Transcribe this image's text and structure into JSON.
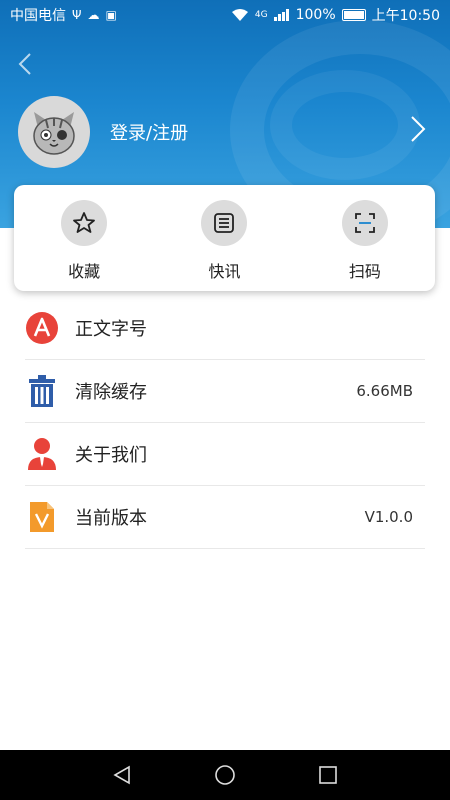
{
  "status_bar": {
    "carrier": "中国电信",
    "signal_type": "4G",
    "battery_percent": "100%",
    "time": "上午10:50"
  },
  "profile": {
    "login_label": "登录/注册"
  },
  "quick_actions": [
    {
      "label": "收藏",
      "icon": "star-icon"
    },
    {
      "label": "快讯",
      "icon": "news-list-icon"
    },
    {
      "label": "扫码",
      "icon": "scan-icon"
    }
  ],
  "settings": [
    {
      "label": "正文字号",
      "value": "",
      "icon": "font-size-icon"
    },
    {
      "label": "清除缓存",
      "value": "6.66MB",
      "icon": "trash-icon"
    },
    {
      "label": "关于我们",
      "value": "",
      "icon": "person-icon"
    },
    {
      "label": "当前版本",
      "value": "V1.0.0",
      "icon": "version-file-icon"
    }
  ],
  "colors": {
    "header_blue": "#1b86cf",
    "font_icon_red": "#e8433a",
    "trash_blue": "#2f5da9",
    "person_red": "#e8433a",
    "version_orange": "#f39a2b"
  }
}
